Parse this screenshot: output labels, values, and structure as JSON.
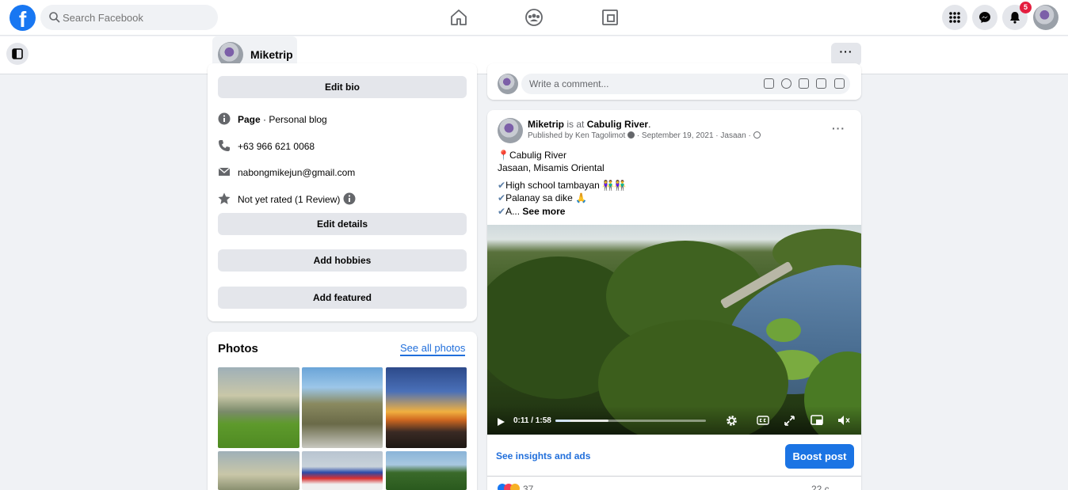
{
  "header": {
    "logo_letter": "f",
    "search_placeholder": "Search Facebook",
    "notification_count": "5",
    "nav_icons": [
      "home-icon",
      "groups-icon",
      "pages-icon"
    ],
    "right_icons": [
      "menu-grid-icon",
      "messenger-icon",
      "bell-icon"
    ]
  },
  "page_bar": {
    "page_name": "Miketrip",
    "more_label": "···"
  },
  "intro": {
    "edit_bio_label": "Edit bio",
    "info": [
      {
        "icon": "info-icon",
        "text_bold": "Page",
        "text": " · Personal blog"
      },
      {
        "icon": "phone-icon",
        "text": "+63 966 621 0068"
      },
      {
        "icon": "mail-icon",
        "text": "nabongmikejun@gmail.com"
      },
      {
        "icon": "star-icon",
        "text": "Not yet rated (1 Review)"
      }
    ],
    "edit_details_label": "Edit details",
    "add_hobbies_label": "Add hobbies",
    "add_featured_label": "Add featured"
  },
  "photos": {
    "title": "Photos",
    "see_all_label": "See all photos"
  },
  "comment": {
    "placeholder": "Write a comment..."
  },
  "post": {
    "author": "Miketrip",
    "is_at": " is at ",
    "place": "Cabulig River",
    "period": ".",
    "published_by": "Published by Ken Tagolimot",
    "date": "September 19, 2021 · Jasaan ·",
    "lines": [
      "📍Cabulig River",
      "Jasaan, Misamis Oriental",
      "High school tambayan 👫👫",
      "Palanay sa dike 🙏",
      "A..."
    ],
    "check_mark": "✔",
    "see_more_label": "See more",
    "more_label": "···",
    "video": {
      "time": "0:11 / 1:58",
      "progress": 0.1
    },
    "insights_label": "See insights and ads",
    "boost_label": "Boost post",
    "reaction_count": "37",
    "comment_count": "22 c"
  },
  "colors": {
    "brand": "#1877f2",
    "boost": "#1b74e4",
    "badge": "#e41e3f"
  }
}
